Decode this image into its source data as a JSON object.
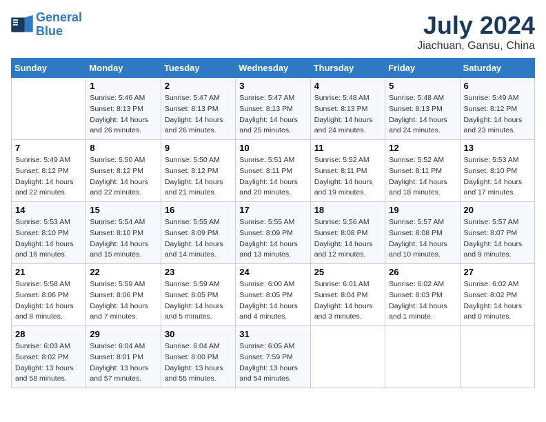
{
  "logo": {
    "line1": "General",
    "line2": "Blue"
  },
  "title": "July 2024",
  "subtitle": "Jiachuan, Gansu, China",
  "weekdays": [
    "Sunday",
    "Monday",
    "Tuesday",
    "Wednesday",
    "Thursday",
    "Friday",
    "Saturday"
  ],
  "weeks": [
    [
      {
        "day": "",
        "sunrise": "",
        "sunset": "",
        "daylight": ""
      },
      {
        "day": "1",
        "sunrise": "Sunrise: 5:46 AM",
        "sunset": "Sunset: 8:13 PM",
        "daylight": "Daylight: 14 hours and 26 minutes."
      },
      {
        "day": "2",
        "sunrise": "Sunrise: 5:47 AM",
        "sunset": "Sunset: 8:13 PM",
        "daylight": "Daylight: 14 hours and 26 minutes."
      },
      {
        "day": "3",
        "sunrise": "Sunrise: 5:47 AM",
        "sunset": "Sunset: 8:13 PM",
        "daylight": "Daylight: 14 hours and 25 minutes."
      },
      {
        "day": "4",
        "sunrise": "Sunrise: 5:48 AM",
        "sunset": "Sunset: 8:13 PM",
        "daylight": "Daylight: 14 hours and 24 minutes."
      },
      {
        "day": "5",
        "sunrise": "Sunrise: 5:48 AM",
        "sunset": "Sunset: 8:13 PM",
        "daylight": "Daylight: 14 hours and 24 minutes."
      },
      {
        "day": "6",
        "sunrise": "Sunrise: 5:49 AM",
        "sunset": "Sunset: 8:12 PM",
        "daylight": "Daylight: 14 hours and 23 minutes."
      }
    ],
    [
      {
        "day": "7",
        "sunrise": "Sunrise: 5:49 AM",
        "sunset": "Sunset: 8:12 PM",
        "daylight": "Daylight: 14 hours and 22 minutes."
      },
      {
        "day": "8",
        "sunrise": "Sunrise: 5:50 AM",
        "sunset": "Sunset: 8:12 PM",
        "daylight": "Daylight: 14 hours and 22 minutes."
      },
      {
        "day": "9",
        "sunrise": "Sunrise: 5:50 AM",
        "sunset": "Sunset: 8:12 PM",
        "daylight": "Daylight: 14 hours and 21 minutes."
      },
      {
        "day": "10",
        "sunrise": "Sunrise: 5:51 AM",
        "sunset": "Sunset: 8:11 PM",
        "daylight": "Daylight: 14 hours and 20 minutes."
      },
      {
        "day": "11",
        "sunrise": "Sunrise: 5:52 AM",
        "sunset": "Sunset: 8:11 PM",
        "daylight": "Daylight: 14 hours and 19 minutes."
      },
      {
        "day": "12",
        "sunrise": "Sunrise: 5:52 AM",
        "sunset": "Sunset: 8:11 PM",
        "daylight": "Daylight: 14 hours and 18 minutes."
      },
      {
        "day": "13",
        "sunrise": "Sunrise: 5:53 AM",
        "sunset": "Sunset: 8:10 PM",
        "daylight": "Daylight: 14 hours and 17 minutes."
      }
    ],
    [
      {
        "day": "14",
        "sunrise": "Sunrise: 5:53 AM",
        "sunset": "Sunset: 8:10 PM",
        "daylight": "Daylight: 14 hours and 16 minutes."
      },
      {
        "day": "15",
        "sunrise": "Sunrise: 5:54 AM",
        "sunset": "Sunset: 8:10 PM",
        "daylight": "Daylight: 14 hours and 15 minutes."
      },
      {
        "day": "16",
        "sunrise": "Sunrise: 5:55 AM",
        "sunset": "Sunset: 8:09 PM",
        "daylight": "Daylight: 14 hours and 14 minutes."
      },
      {
        "day": "17",
        "sunrise": "Sunrise: 5:55 AM",
        "sunset": "Sunset: 8:09 PM",
        "daylight": "Daylight: 14 hours and 13 minutes."
      },
      {
        "day": "18",
        "sunrise": "Sunrise: 5:56 AM",
        "sunset": "Sunset: 8:08 PM",
        "daylight": "Daylight: 14 hours and 12 minutes."
      },
      {
        "day": "19",
        "sunrise": "Sunrise: 5:57 AM",
        "sunset": "Sunset: 8:08 PM",
        "daylight": "Daylight: 14 hours and 10 minutes."
      },
      {
        "day": "20",
        "sunrise": "Sunrise: 5:57 AM",
        "sunset": "Sunset: 8:07 PM",
        "daylight": "Daylight: 14 hours and 9 minutes."
      }
    ],
    [
      {
        "day": "21",
        "sunrise": "Sunrise: 5:58 AM",
        "sunset": "Sunset: 8:06 PM",
        "daylight": "Daylight: 14 hours and 8 minutes."
      },
      {
        "day": "22",
        "sunrise": "Sunrise: 5:59 AM",
        "sunset": "Sunset: 8:06 PM",
        "daylight": "Daylight: 14 hours and 7 minutes."
      },
      {
        "day": "23",
        "sunrise": "Sunrise: 5:59 AM",
        "sunset": "Sunset: 8:05 PM",
        "daylight": "Daylight: 14 hours and 5 minutes."
      },
      {
        "day": "24",
        "sunrise": "Sunrise: 6:00 AM",
        "sunset": "Sunset: 8:05 PM",
        "daylight": "Daylight: 14 hours and 4 minutes."
      },
      {
        "day": "25",
        "sunrise": "Sunrise: 6:01 AM",
        "sunset": "Sunset: 8:04 PM",
        "daylight": "Daylight: 14 hours and 3 minutes."
      },
      {
        "day": "26",
        "sunrise": "Sunrise: 6:02 AM",
        "sunset": "Sunset: 8:03 PM",
        "daylight": "Daylight: 14 hours and 1 minute."
      },
      {
        "day": "27",
        "sunrise": "Sunrise: 6:02 AM",
        "sunset": "Sunset: 8:02 PM",
        "daylight": "Daylight: 14 hours and 0 minutes."
      }
    ],
    [
      {
        "day": "28",
        "sunrise": "Sunrise: 6:03 AM",
        "sunset": "Sunset: 8:02 PM",
        "daylight": "Daylight: 13 hours and 58 minutes."
      },
      {
        "day": "29",
        "sunrise": "Sunrise: 6:04 AM",
        "sunset": "Sunset: 8:01 PM",
        "daylight": "Daylight: 13 hours and 57 minutes."
      },
      {
        "day": "30",
        "sunrise": "Sunrise: 6:04 AM",
        "sunset": "Sunset: 8:00 PM",
        "daylight": "Daylight: 13 hours and 55 minutes."
      },
      {
        "day": "31",
        "sunrise": "Sunrise: 6:05 AM",
        "sunset": "Sunset: 7:59 PM",
        "daylight": "Daylight: 13 hours and 54 minutes."
      },
      {
        "day": "",
        "sunrise": "",
        "sunset": "",
        "daylight": ""
      },
      {
        "day": "",
        "sunrise": "",
        "sunset": "",
        "daylight": ""
      },
      {
        "day": "",
        "sunrise": "",
        "sunset": "",
        "daylight": ""
      }
    ]
  ]
}
